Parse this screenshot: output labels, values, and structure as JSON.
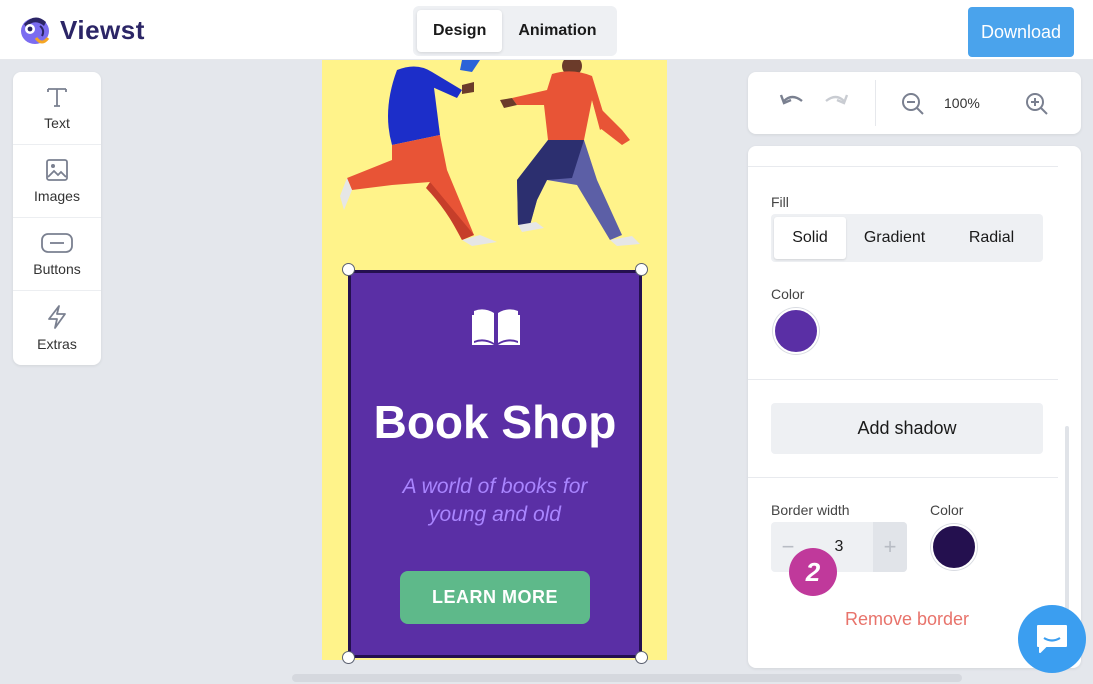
{
  "app": {
    "name": "Viewst"
  },
  "header": {
    "tabs": [
      {
        "label": "Design",
        "active": true
      },
      {
        "label": "Animation",
        "active": false
      }
    ],
    "download_label": "Download"
  },
  "tools": [
    {
      "label": "Text",
      "icon": "text-icon"
    },
    {
      "label": "Images",
      "icon": "image-icon"
    },
    {
      "label": "Buttons",
      "icon": "button-icon"
    },
    {
      "label": "Extras",
      "icon": "lightning-icon"
    }
  ],
  "canvas": {
    "background": "#fff38a",
    "card": {
      "title": "Book Shop",
      "subtitle": "A world of books for young and old",
      "button_label": "LEARN MORE",
      "background": "#5a2fa5",
      "border_color": "#24104f"
    }
  },
  "zoom": {
    "level": "100%"
  },
  "properties": {
    "fill_label": "Fill",
    "fill_tabs": [
      {
        "label": "Solid",
        "active": true
      },
      {
        "label": "Gradient",
        "active": false
      },
      {
        "label": "Radial",
        "active": false
      }
    ],
    "color_label": "Color",
    "fill_color": "#5a2fa5",
    "shadow_label": "Add shadow",
    "border_width_label": "Border width",
    "border_width_value": "3",
    "border_color_label": "Color",
    "border_color": "#24104f",
    "remove_border_label": "Remove border"
  },
  "overlay": {
    "step_badge": "2"
  },
  "colors": {
    "accent": "#4aa3ec",
    "danger": "#e8736b",
    "badge": "#c0399b",
    "button": "#5eb98a"
  }
}
